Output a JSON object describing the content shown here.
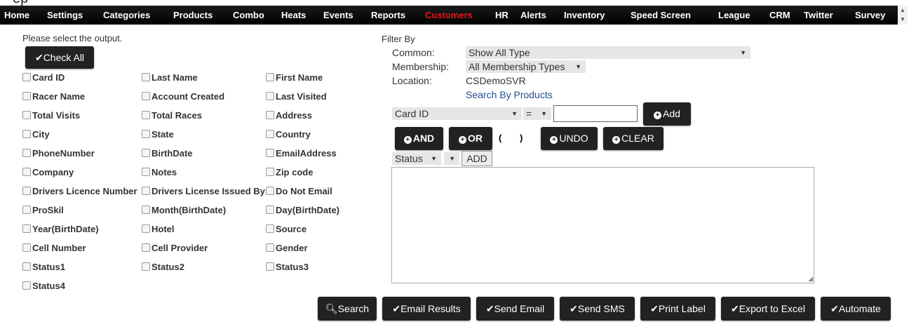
{
  "top_clip": {
    "fragment": "ep"
  },
  "nav": {
    "items": [
      {
        "label": "Home"
      },
      {
        "label": "Settings"
      },
      {
        "label": "Categories"
      },
      {
        "label": "Products"
      },
      {
        "label": "Combo"
      },
      {
        "label": "Heats"
      },
      {
        "label": "Events"
      },
      {
        "label": "Reports"
      },
      {
        "label": "Customers",
        "active": true
      },
      {
        "label": "HR"
      },
      {
        "label": "Alerts"
      },
      {
        "label": "Inventory"
      },
      {
        "label": "Speed Screen"
      },
      {
        "label": "League"
      },
      {
        "label": "CRM"
      },
      {
        "label": "Twitter"
      },
      {
        "label": "Survey"
      }
    ],
    "active_color": "#e8141a"
  },
  "output": {
    "prompt": "Please select the output.",
    "check_all_label": "Check All",
    "fields": [
      [
        "Card ID",
        "Last Name",
        "First Name"
      ],
      [
        "Racer Name",
        "Account Created",
        "Last Visited"
      ],
      [
        "Total Visits",
        "Total Races",
        "Address"
      ],
      [
        "City",
        "State",
        "Country"
      ],
      [
        "PhoneNumber",
        "BirthDate",
        "EmailAddress"
      ],
      [
        "Company",
        "Notes",
        "Zip code"
      ],
      [
        "Drivers Licence Number",
        "Drivers License Issued By",
        "Do Not Email"
      ],
      [
        "ProSkil",
        "Month(BirthDate)",
        "Day(BirthDate)"
      ],
      [
        "Year(BirthDate)",
        "Hotel",
        "Source"
      ],
      [
        "Cell Number",
        "Cell Provider",
        "Gender"
      ],
      [
        "Status1",
        "Status2",
        "Status3"
      ],
      [
        "Status4"
      ]
    ]
  },
  "filter": {
    "heading": "Filter By",
    "common_label": "Common:",
    "common_value": "Show All Type",
    "membership_label": "Membership:",
    "membership_value": "All Membership Types",
    "location_label": "Location:",
    "location_value": "CSDemoSVR",
    "search_by_products": "Search By Products",
    "field_select": "Card ID",
    "operator_select": "=",
    "value_input": "",
    "add_label": "Add",
    "and_label": "AND",
    "or_label": "OR",
    "open_paren": "(",
    "close_paren": ")",
    "undo_label": "UNDO",
    "clear_label": "CLEAR",
    "status_select": "Status",
    "status_value_select": "",
    "status_add_label": "ADD",
    "query_text": ""
  },
  "actions": {
    "search": "Search",
    "email_results": "Email Results",
    "send_email": "Send Email",
    "send_sms": "Send SMS",
    "print_label": "Print Label",
    "export_excel": "Export to Excel",
    "automate": "Automate"
  }
}
